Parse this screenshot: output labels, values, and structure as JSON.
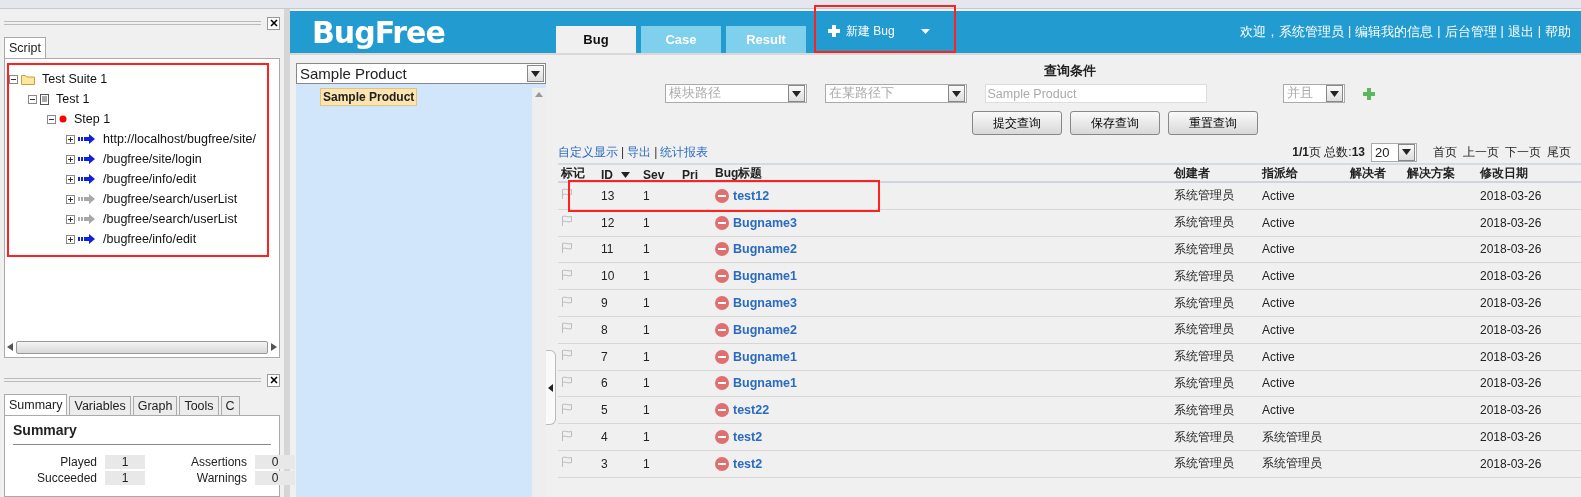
{
  "left_panel": {
    "script_tab": {
      "label": "Script",
      "selected": true
    },
    "tree": {
      "highlighted": true,
      "items": [
        {
          "label": "Test Suite 1",
          "kind": "suite",
          "expanded": true,
          "children": [
            {
              "label": "Test 1",
              "kind": "test",
              "expanded": true,
              "children": [
                {
                  "label": "Step 1",
                  "kind": "step",
                  "expanded": true,
                  "children": [
                    {
                      "label": "http://localhost/bugfree/site/",
                      "kind": "request",
                      "enabled": true,
                      "expanded": false
                    },
                    {
                      "label": "/bugfree/site/login",
                      "kind": "request",
                      "enabled": true,
                      "expanded": false
                    },
                    {
                      "label": "/bugfree/info/edit",
                      "kind": "request",
                      "enabled": true,
                      "expanded": false
                    },
                    {
                      "label": "/bugfree/search/userList",
                      "kind": "request",
                      "enabled": false,
                      "expanded": false
                    },
                    {
                      "label": "/bugfree/search/userList",
                      "kind": "request",
                      "enabled": false,
                      "expanded": false
                    },
                    {
                      "label": "/bugfree/info/edit",
                      "kind": "request",
                      "enabled": true,
                      "expanded": false
                    }
                  ]
                }
              ]
            }
          ]
        }
      ]
    },
    "summary_tabs": [
      {
        "label": "Summary",
        "selected": true
      },
      {
        "label": "Variables",
        "selected": false
      },
      {
        "label": "Graph",
        "selected": false
      },
      {
        "label": "Tools",
        "selected": false
      },
      {
        "label": "C",
        "selected": false
      }
    ],
    "summary": {
      "title": "Summary",
      "stats": [
        {
          "label": "Played",
          "value": "1"
        },
        {
          "label": "Assertions",
          "value": "0"
        },
        {
          "label": "Succeeded",
          "value": "1"
        },
        {
          "label": "Warnings",
          "value": "0"
        }
      ]
    }
  },
  "header": {
    "logo": "BugFree",
    "tabs": [
      {
        "label": "Bug",
        "selected": true
      },
      {
        "label": "Case",
        "selected": false
      },
      {
        "label": "Result",
        "selected": false
      }
    ],
    "new_bug": {
      "label": "新建 Bug",
      "highlighted": true
    },
    "separator": "|",
    "user_links": [
      "欢迎，系统管理员",
      "编辑我的信息",
      "后台管理",
      "退出",
      "帮助"
    ]
  },
  "product_panel": {
    "select": "Sample Product",
    "items": [
      {
        "label": "Sample Product",
        "selected": true
      }
    ]
  },
  "query": {
    "title": "查询条件",
    "conditions": [
      {
        "field": "模块路径",
        "operator": "在某路径下",
        "placeholder": "Sample Product",
        "join": "并且"
      }
    ],
    "buttons": [
      "提交查询",
      "保存查询",
      "重置查询"
    ]
  },
  "toolbar": {
    "separator": "|",
    "links": [
      "自定义显示",
      "导出",
      "统计报表"
    ]
  },
  "pagination": {
    "summary": "**1/1**页 总数:**13**",
    "page_size": "20",
    "links": [
      "首页",
      "上一页",
      "下一页",
      "尾页"
    ]
  },
  "table": {
    "columns": [
      {
        "label": "标记",
        "sorted": false
      },
      {
        "label": "ID",
        "sorted": true
      },
      {
        "label": "Sev",
        "sorted": false
      },
      {
        "label": "Pri",
        "sorted": false
      },
      {
        "label": "Bug标题",
        "sorted": false
      },
      {
        "label": "创建者",
        "sorted": false
      },
      {
        "label": "指派给",
        "sorted": false
      },
      {
        "label": "解决者",
        "sorted": false
      },
      {
        "label": "解决方案",
        "sorted": false
      },
      {
        "label": "修改日期",
        "sorted": false
      }
    ],
    "rows": [
      {
        "id": "13",
        "sev": "1",
        "title": "test12",
        "creator": "系统管理员",
        "assignee": "Active",
        "date": "2018-03-26",
        "highlighted": true
      },
      {
        "id": "12",
        "sev": "1",
        "title": "Bugname3",
        "creator": "系统管理员",
        "assignee": "Active",
        "date": "2018-03-26",
        "highlighted": false
      },
      {
        "id": "11",
        "sev": "1",
        "title": "Bugname2",
        "creator": "系统管理员",
        "assignee": "Active",
        "date": "2018-03-26",
        "highlighted": false
      },
      {
        "id": "10",
        "sev": "1",
        "title": "Bugname1",
        "creator": "系统管理员",
        "assignee": "Active",
        "date": "2018-03-26",
        "highlighted": false
      },
      {
        "id": "9",
        "sev": "1",
        "title": "Bugname3",
        "creator": "系统管理员",
        "assignee": "Active",
        "date": "2018-03-26",
        "highlighted": false
      },
      {
        "id": "8",
        "sev": "1",
        "title": "Bugname2",
        "creator": "系统管理员",
        "assignee": "Active",
        "date": "2018-03-26",
        "highlighted": false
      },
      {
        "id": "7",
        "sev": "1",
        "title": "Bugname1",
        "creator": "系统管理员",
        "assignee": "Active",
        "date": "2018-03-26",
        "highlighted": false
      },
      {
        "id": "6",
        "sev": "1",
        "title": "Bugname1",
        "creator": "系统管理员",
        "assignee": "Active",
        "date": "2018-03-26",
        "highlighted": false
      },
      {
        "id": "5",
        "sev": "1",
        "title": "test22",
        "creator": "系统管理员",
        "assignee": "Active",
        "date": "2018-03-26",
        "highlighted": false
      },
      {
        "id": "4",
        "sev": "1",
        "title": "test2",
        "creator": "系统管理员",
        "assignee": "系统管理员",
        "date": "2018-03-26",
        "highlighted": false
      },
      {
        "id": "3",
        "sev": "1",
        "title": "test2",
        "creator": "系统管理员",
        "assignee": "系统管理员",
        "date": "2018-03-26",
        "highlighted": false
      }
    ]
  }
}
